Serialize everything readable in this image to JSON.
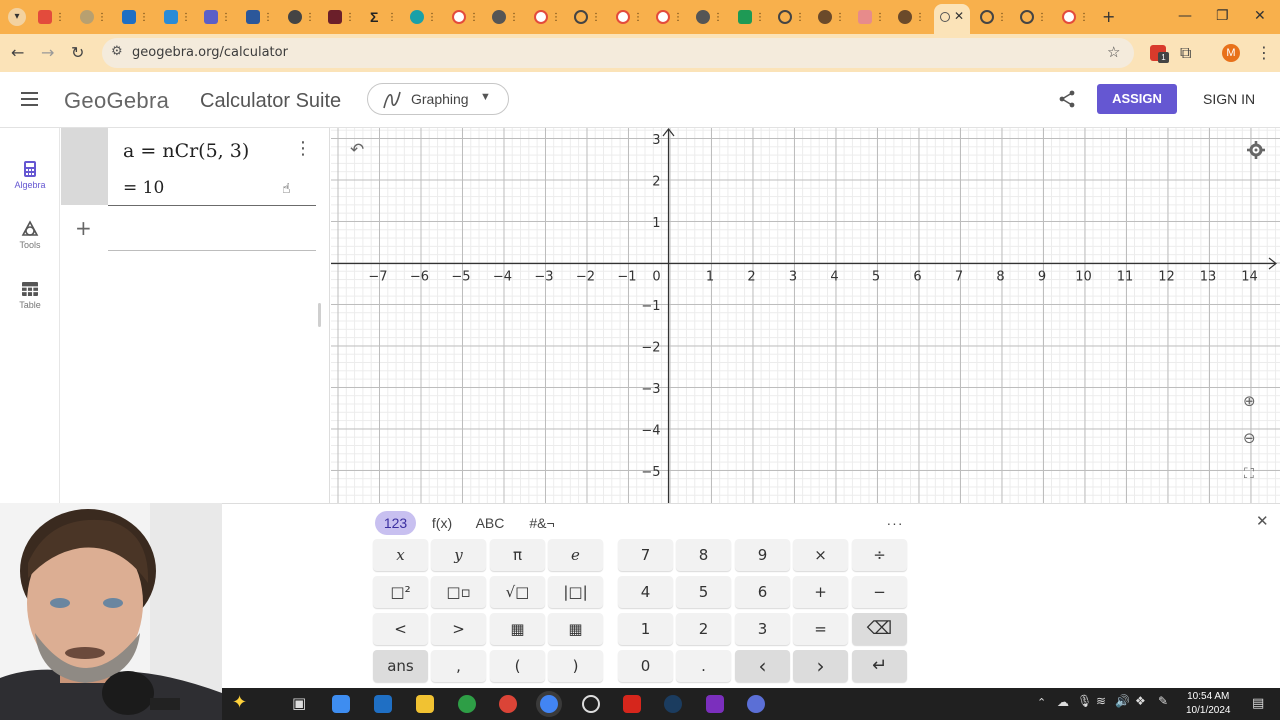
{
  "browser": {
    "url": "geogebra.org/calculator",
    "profile_initial": "M",
    "extension_badge": "1"
  },
  "header": {
    "brand": "GeoGebra",
    "suite": "Calculator Suite",
    "app_label": "Graphing",
    "assign_label": "ASSIGN",
    "signin_label": "SIGN IN"
  },
  "rail": {
    "items": [
      {
        "label": "Algebra",
        "icon": "calculator-icon"
      },
      {
        "label": "Tools",
        "icon": "tools-icon"
      },
      {
        "label": "Table",
        "icon": "table-icon"
      }
    ]
  },
  "algebra": {
    "expression": "a  =  nCr(5, 3)",
    "result": "=  10"
  },
  "graph": {
    "x_ticks": [
      "−7",
      "−6",
      "−5",
      "−4",
      "−3",
      "−2",
      "−1",
      "0",
      "1",
      "2",
      "3",
      "4",
      "5",
      "6",
      "7",
      "8",
      "9",
      "10",
      "11",
      "12",
      "13",
      "14"
    ],
    "y_ticks_pos": [
      "3",
      "2",
      "1"
    ],
    "y_ticks_neg": [
      "−1",
      "−2",
      "−3",
      "−4",
      "−5"
    ]
  },
  "keyboard": {
    "tabs": [
      "123",
      "f(x)",
      "ABC",
      "#&¬"
    ],
    "more": "···",
    "left_rows": [
      [
        "x",
        "y",
        "π",
        "e"
      ],
      [
        "□²",
        "□▫",
        "√□",
        "|□|"
      ],
      [
        "<",
        ">",
        "▦",
        "▦"
      ],
      [
        "ans",
        ",",
        "(",
        ")"
      ]
    ],
    "num_rows": [
      [
        "7",
        "8",
        "9",
        "×",
        "÷"
      ],
      [
        "4",
        "5",
        "6",
        "+",
        "−"
      ],
      [
        "1",
        "2",
        "3",
        "=",
        "⌫"
      ],
      [
        "0",
        ".",
        "‹",
        "›",
        "↵"
      ]
    ]
  },
  "taskbar": {
    "time": "10:54 AM",
    "date": "10/1/2024"
  },
  "colors": {
    "tabstrip": "#f8b04c",
    "addressbar": "#fbe3b8",
    "assign": "#6557d2",
    "active_tab": "#c8c0f0"
  }
}
